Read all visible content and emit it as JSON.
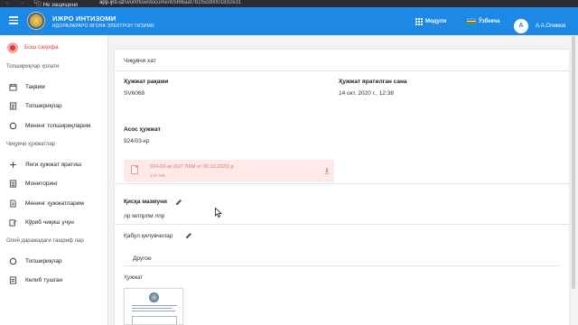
{
  "browser": {
    "nav": "← → C",
    "security_warning": "ⓘ Не защищено",
    "url_host": "app.ijro.uz",
    "url_path": "/workflow/document/5f86aaf7b1f5cd0001832e31"
  },
  "header": {
    "title": "ИЖРО ИНТИЗОМИ",
    "subtitle": "ИДОРАЛАРАРО ЯГОНА ЭЛЕКТРОН ТИЗИМИ",
    "modules_label": "Модули",
    "language_label": "Ўзбекча",
    "avatar_initial": "A",
    "user_name": "А.А.Олимов",
    "accent_color": "#1e88e5"
  },
  "sidebar": {
    "home": "Бош саҳифа",
    "sections": [
      {
        "title": "Топшириқлар ҳолати",
        "items": [
          {
            "label": "Тақвим",
            "icon": "calendar-icon"
          },
          {
            "label": "Топшириқлар",
            "icon": "list-icon"
          },
          {
            "label": "Менинг топшириқларим",
            "icon": "task-icon"
          }
        ]
      },
      {
        "title": "Чиқувчи ҳужжатлар",
        "items": [
          {
            "label": "Янги ҳужжат яратиш",
            "icon": "plus-icon"
          },
          {
            "label": "Мониторинг",
            "icon": "monitor-icon"
          },
          {
            "label": "Менинг ҳужжатларим",
            "icon": "document-icon"
          },
          {
            "label": "Кўриб чиқиш учун",
            "icon": "edit-icon"
          }
        ]
      },
      {
        "title": "Олий даражадаги ташриф лар",
        "items": [
          {
            "label": "Топшириқлар",
            "icon": "task-icon"
          },
          {
            "label": "Келиб тушган",
            "icon": "inbox-icon"
          }
        ]
      }
    ]
  },
  "document": {
    "card_title": "Чиқувчи хат",
    "doc_number_label": "Ҳужжат рақами",
    "doc_number_value": "SV6068",
    "created_date_label": "Ҳужжат яратилган сана",
    "created_date_value": "14 окт. 2020 г., 12:38",
    "basis_label": "Асос ҳужжат",
    "basis_value": "924/03-кр",
    "attachment_name": "924-03-кр (637 ПКМ от 09.10.2020).p",
    "attachment_size": "2.97 МБ",
    "summary_label": "Қисқа мазмуни",
    "summary_value": "лр млпрпм лпр",
    "recipients_label": "Қабул қилувчилар",
    "other_label": "Другое",
    "document_label": "Ҳужжат"
  }
}
